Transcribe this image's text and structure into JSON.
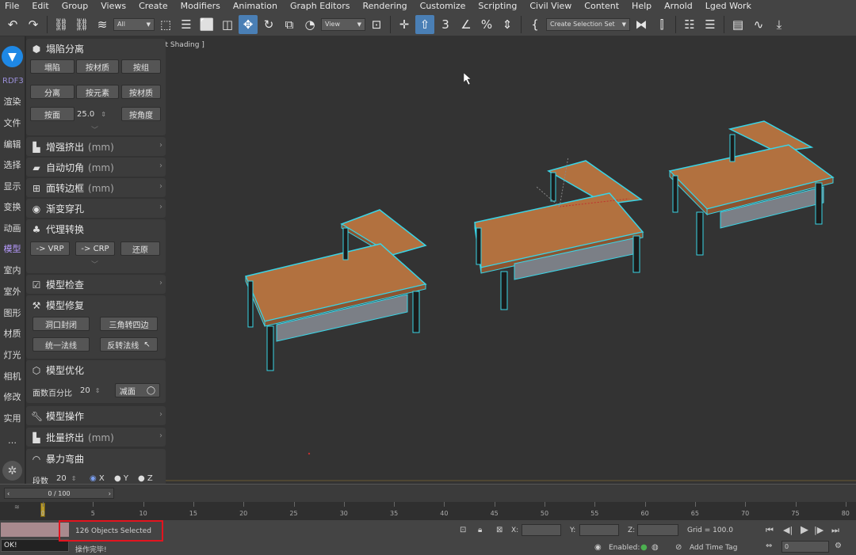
{
  "menu": [
    "File",
    "Edit",
    "Group",
    "Views",
    "Create",
    "Modifiers",
    "Animation",
    "Graph Editors",
    "Rendering",
    "Customize",
    "Scripting",
    "Civil View",
    "Content",
    "Help",
    "Arnold",
    "Lged Work"
  ],
  "toolbar": {
    "filter_value": "All",
    "refcoord_value": "View",
    "selection_set_value": "Create Selection Set"
  },
  "left_tabs": {
    "rdf_label": "RDF3",
    "items": [
      "渲染",
      "文件",
      "编辑",
      "选择",
      "显示",
      "变换",
      "动画",
      "模型",
      "室内",
      "室外",
      "图形",
      "材质",
      "灯光",
      "相机",
      "修改",
      "实用",
      "…"
    ]
  },
  "panel": {
    "collapse": {
      "title": "塌陷分离",
      "btn_collapse": "塌陷",
      "btn_by_material": "按材质",
      "btn_by_group": "按组",
      "btn_detach": "分离",
      "btn_by_element": "按元素",
      "btn_by_material2": "按材质",
      "btn_by_face": "按面",
      "angle_value": "25.0",
      "btn_by_angle": "按角度"
    },
    "extrude": {
      "title": "增强挤出",
      "unit": "(mm)"
    },
    "chamfer": {
      "title": "自动切角",
      "unit": "(mm)"
    },
    "face_frame": {
      "title": "面转边框",
      "unit": "(mm)"
    },
    "gradient_hole": {
      "title": "渐变穿孔"
    },
    "proxy": {
      "title": "代理转换",
      "btn_vrp": "-> VRP",
      "btn_crp": "-> CRP",
      "btn_restore": "还原"
    },
    "check": {
      "title": "模型检查"
    },
    "repair": {
      "title": "模型修复",
      "btn_close_hole": "洞口封闭",
      "btn_tri_quad": "三角转四边",
      "btn_unify_normals": "统一法线",
      "btn_flip_normals": "反转法线"
    },
    "optimize": {
      "title": "模型优化",
      "percent_label": "面数百分比",
      "percent_value": "20",
      "btn_reduce": "减面"
    },
    "operate": {
      "title": "模型操作"
    },
    "batch_extrude": {
      "title": "批量挤出",
      "unit": "(mm)"
    },
    "bend": {
      "title": "暴力弯曲",
      "segments_label": "段数",
      "segments_value": "20",
      "axis_x": "X",
      "axis_y": "Y",
      "axis_z": "Z"
    }
  },
  "viewport": {
    "label": "lt Shading ]"
  },
  "timeline": {
    "frame_display": "0 / 100",
    "current_frame": 0,
    "ticks": [
      "0",
      "5",
      "10",
      "15",
      "20",
      "25",
      "30",
      "35",
      "40",
      "45",
      "50",
      "55",
      "60",
      "65",
      "70",
      "75",
      "80"
    ]
  },
  "status": {
    "selection_text": "126 Objects Selected",
    "ok_text": "OK!",
    "prompt_text": "操作完毕!",
    "x_label": "X:",
    "y_label": "Y:",
    "z_label": "Z:",
    "grid_text": "Grid = 100.0",
    "enabled_label": "Enabled:",
    "add_time_tag": "Add Time Tag",
    "frame_value": "0"
  },
  "colors": {
    "selection_highlight": "#3ad4e6",
    "wood_top": "#b2713f",
    "wood_side": "#8c5430",
    "accent_blue": "#4a7fb5",
    "red_box": "#e3141f"
  }
}
